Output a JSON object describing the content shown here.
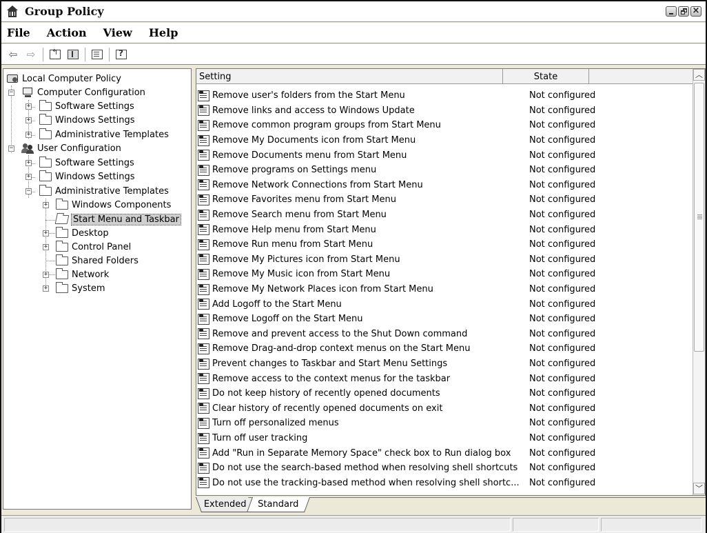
{
  "window": {
    "title": "Group Policy"
  },
  "menu": [
    "File",
    "Action",
    "View",
    "Help"
  ],
  "toolbar": {
    "back_icon": "back-arrow-icon",
    "forward_icon": "forward-arrow-icon"
  },
  "tree": {
    "root": "Local Computer Policy",
    "computer_config": "Computer Configuration",
    "cc_software": "Software Settings",
    "cc_windows": "Windows Settings",
    "cc_admin": "Administrative Templates",
    "user_config": "User Configuration",
    "uc_software": "Software Settings",
    "uc_windows": "Windows Settings",
    "uc_admin": "Administrative Templates",
    "windows_components": "Windows Components",
    "start_menu": "Start Menu and Taskbar",
    "desktop": "Desktop",
    "control_panel": "Control Panel",
    "shared_folders": "Shared Folders",
    "network": "Network",
    "system": "System"
  },
  "list": {
    "columns": [
      "Setting",
      "State"
    ],
    "rows": [
      [
        "Remove user's folders from the Start Menu",
        "Not configured"
      ],
      [
        "Remove links and access to Windows Update",
        "Not configured"
      ],
      [
        "Remove common program groups from Start Menu",
        "Not configured"
      ],
      [
        "Remove My Documents icon from Start Menu",
        "Not configured"
      ],
      [
        "Remove Documents menu from Start Menu",
        "Not configured"
      ],
      [
        "Remove programs on Settings menu",
        "Not configured"
      ],
      [
        "Remove Network Connections from Start Menu",
        "Not configured"
      ],
      [
        "Remove Favorites menu from Start Menu",
        "Not configured"
      ],
      [
        "Remove Search menu from Start Menu",
        "Not configured"
      ],
      [
        "Remove Help menu from Start Menu",
        "Not configured"
      ],
      [
        "Remove Run menu from Start Menu",
        "Not configured"
      ],
      [
        "Remove My Pictures icon from Start Menu",
        "Not configured"
      ],
      [
        "Remove My Music icon from Start Menu",
        "Not configured"
      ],
      [
        "Remove My Network Places icon from Start Menu",
        "Not configured"
      ],
      [
        "Add Logoff to the Start Menu",
        "Not configured"
      ],
      [
        "Remove Logoff on the Start Menu",
        "Not configured"
      ],
      [
        "Remove and prevent access to the Shut Down command",
        "Not configured"
      ],
      [
        "Remove Drag-and-drop context menus on the Start Menu",
        "Not configured"
      ],
      [
        "Prevent changes to Taskbar and Start Menu Settings",
        "Not configured"
      ],
      [
        "Remove access to the context menus for the taskbar",
        "Not configured"
      ],
      [
        "Do not keep history of recently opened documents",
        "Not configured"
      ],
      [
        "Clear history of recently opened documents on exit",
        "Not configured"
      ],
      [
        "Turn off personalized menus",
        "Not configured"
      ],
      [
        "Turn off user tracking",
        "Not configured"
      ],
      [
        "Add \"Run in Separate Memory Space\" check box to Run dialog box",
        "Not configured"
      ],
      [
        "Do not use the search-based method when resolving shell shortcuts",
        "Not configured"
      ],
      [
        "Do not use the tracking-based method when resolving shell shortc...",
        "Not configured"
      ]
    ]
  },
  "tabs": {
    "extended": "Extended",
    "standard": "Standard",
    "active": "Standard"
  }
}
